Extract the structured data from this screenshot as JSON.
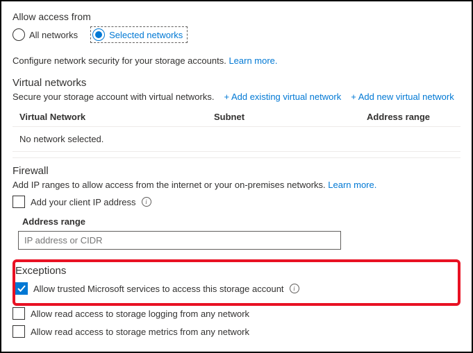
{
  "access": {
    "title": "Allow access from",
    "all_label": "All networks",
    "selected_label": "Selected networks"
  },
  "helper": {
    "text": "Configure network security for your storage accounts. ",
    "link": "Learn more."
  },
  "vnet": {
    "title": "Virtual networks",
    "subtext": "Secure your storage account with virtual networks.",
    "add_existing": "+ Add existing virtual network",
    "add_new": "+ Add new virtual network",
    "col_vn": "Virtual Network",
    "col_subnet": "Subnet",
    "col_range": "Address range",
    "empty": "No network selected."
  },
  "firewall": {
    "title": "Firewall",
    "subtext": "Add IP ranges to allow access from the internet or your on-premises networks. ",
    "link": "Learn more.",
    "add_client_ip": "Add your client IP address",
    "addr_label": "Address range",
    "addr_placeholder": "IP address or CIDR"
  },
  "exceptions": {
    "title": "Exceptions",
    "opt_trusted": "Allow trusted Microsoft services to access this storage account",
    "opt_logging": "Allow read access to storage logging from any network",
    "opt_metrics": "Allow read access to storage metrics from any network"
  }
}
